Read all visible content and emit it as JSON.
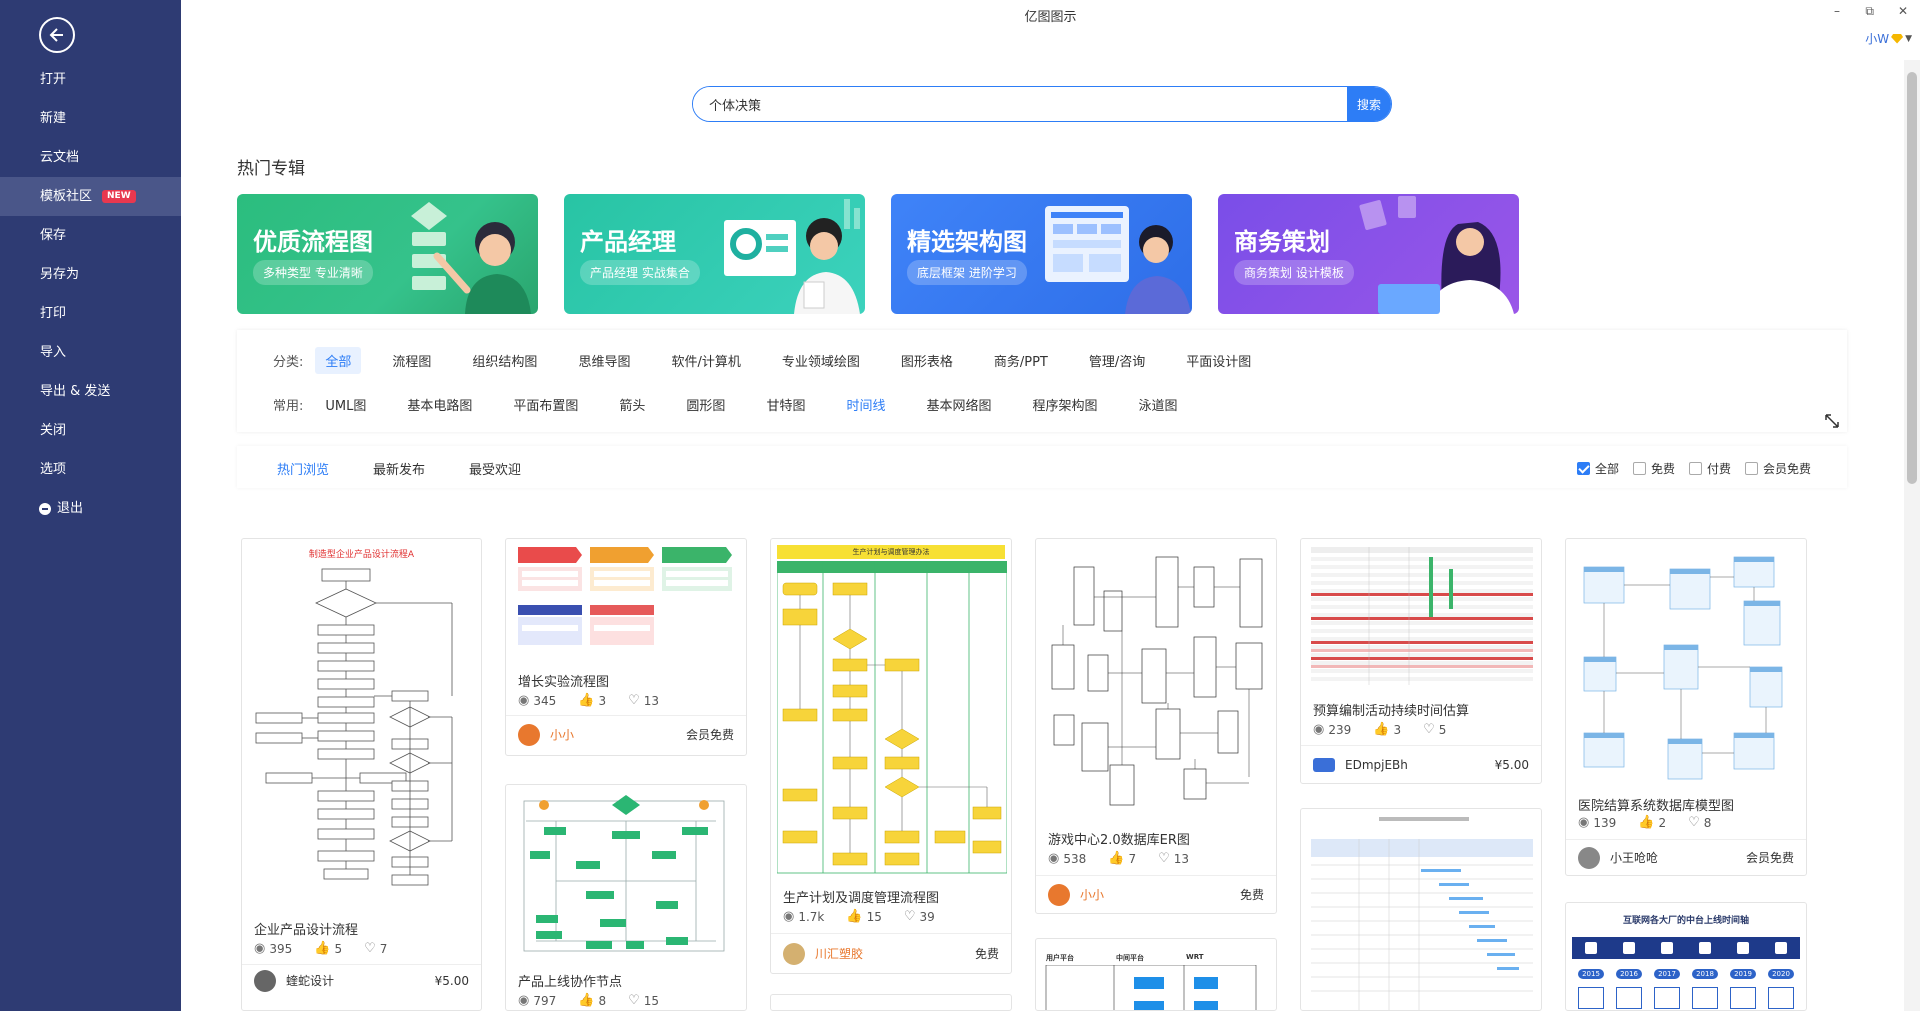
{
  "app": {
    "title": "亿图图示",
    "user": "小W"
  },
  "window_controls": {
    "minimize": "–",
    "maximize": "⧉",
    "close": "✕"
  },
  "sidebar": {
    "items": [
      {
        "label": "打开"
      },
      {
        "label": "新建"
      },
      {
        "label": "云文档"
      },
      {
        "label": "模板社区",
        "badge": "NEW"
      },
      {
        "label": "保存"
      },
      {
        "label": "另存为"
      },
      {
        "label": "打印"
      },
      {
        "label": "导入"
      },
      {
        "label": "导出 & 发送"
      },
      {
        "label": "关闭"
      },
      {
        "label": "选项"
      },
      {
        "label": "退出"
      }
    ]
  },
  "search": {
    "value": "个体决策",
    "button": "搜索"
  },
  "hot": {
    "title": "热门专辑",
    "banners": [
      {
        "title": "优质流程图",
        "subtitle": "多种类型 专业清晰",
        "color": "#2bbd7e"
      },
      {
        "title": "产品经理",
        "subtitle": "产品经理 实战集合",
        "color": "#28c4a4"
      },
      {
        "title": "精选架构图",
        "subtitle": "底层框架 进阶学习",
        "color": "#3f83f8"
      },
      {
        "title": "商务策划",
        "subtitle": "商务策划 设计模板",
        "color": "#8a52e8"
      }
    ]
  },
  "filters": {
    "category_label": "分类:",
    "categories": [
      "全部",
      "流程图",
      "组织结构图",
      "思维导图",
      "软件/计算机",
      "专业领域绘图",
      "图形表格",
      "商务/PPT",
      "管理/咨询",
      "平面设计图"
    ],
    "common_label": "常用:",
    "common": [
      "UML图",
      "基本电路图",
      "平面布置图",
      "箭头",
      "圆形图",
      "甘特图",
      "时间线",
      "基本网络图",
      "程序架构图",
      "泳道图"
    ]
  },
  "sort": {
    "tabs": [
      "热门浏览",
      "最新发布",
      "最受欢迎"
    ],
    "price": [
      "全部",
      "免费",
      "付费",
      "会员免费"
    ]
  },
  "cards": {
    "c1": {
      "thumb_title": "制造型企业产品设计流程A",
      "title": "企业产品设计流程",
      "views": "395",
      "likes": "5",
      "favs": "7",
      "author": "蝰蛇设计",
      "price": "¥5.00"
    },
    "c2": {
      "title": "增长实验流程图",
      "views": "345",
      "likes": "3",
      "favs": "13",
      "author": "小小",
      "price": "会员免费"
    },
    "c3": {
      "title": "产品上线协作节点",
      "views": "797",
      "likes": "8",
      "favs": "15"
    },
    "c4": {
      "thumb_title": "生产计划与调度管理办法",
      "title": "生产计划及调度管理流程图",
      "views": "1.7k",
      "likes": "15",
      "favs": "39",
      "author": "川汇塑胶",
      "price": "免费"
    },
    "c5": {
      "title": "游戏中心2.0数据库ER图",
      "views": "538",
      "likes": "7",
      "favs": "13",
      "author": "小小",
      "price": "免费"
    },
    "c6": {
      "title": "预算编制活动持续时间估算",
      "views": "239",
      "likes": "3",
      "favs": "5",
      "author": "EDmpjEBh",
      "price": "¥5.00"
    },
    "c7": {
      "title": "医院结算系统数据库模型图",
      "views": "139",
      "likes": "2",
      "favs": "8",
      "author": "小王呛呛",
      "price": "会员免费"
    },
    "c8": {
      "thumb_title": "互联网各大厂的中台上线时间轴",
      "years": [
        "2015",
        "2016",
        "2017",
        "2018",
        "2019",
        "2020"
      ]
    },
    "c9": {
      "labels": [
        "用户平台",
        "中间平台",
        "WRT"
      ]
    }
  },
  "colors": {
    "sidebar": "#2e3b73",
    "accent": "#2d7df6",
    "badge": "#e8384f"
  }
}
